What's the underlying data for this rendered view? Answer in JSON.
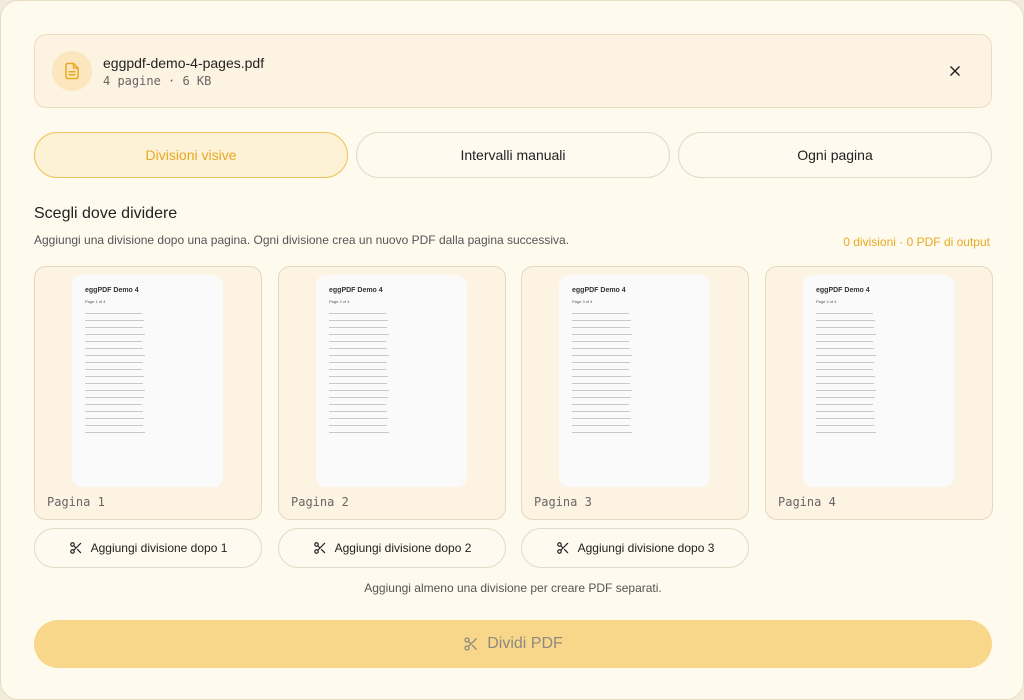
{
  "file": {
    "name": "eggpdf-demo-4-pages.pdf",
    "meta": "4 pagine · 6 KB",
    "icon": "file-text-icon",
    "close_icon": "close-icon"
  },
  "tabs": [
    {
      "label": "Divisioni visive",
      "active": true
    },
    {
      "label": "Intervalli manuali",
      "active": false
    },
    {
      "label": "Ogni pagina",
      "active": false
    }
  ],
  "section": {
    "title": "Scegli dove dividere",
    "description": "Aggiungi una divisione dopo una pagina. Ogni divisione crea un nuovo PDF dalla pagina successiva.",
    "summary": "0 divisioni · 0 PDF di output"
  },
  "pages": [
    {
      "label": "Pagina 1",
      "thumb_title": "eggPDF Demo 4",
      "thumb_sub": "Page 1 of 4"
    },
    {
      "label": "Pagina 2",
      "thumb_title": "eggPDF Demo 4",
      "thumb_sub": "Page 2 of 4"
    },
    {
      "label": "Pagina 3",
      "thumb_title": "eggPDF Demo 4",
      "thumb_sub": "Page 3 of 4"
    },
    {
      "label": "Pagina 4",
      "thumb_title": "eggPDF Demo 4",
      "thumb_sub": "Page 4 of 4"
    }
  ],
  "split_buttons": [
    {
      "label": "Aggiungi divisione dopo 1",
      "icon": "scissors-icon"
    },
    {
      "label": "Aggiungi divisione dopo 2",
      "icon": "scissors-icon"
    },
    {
      "label": "Aggiungi divisione dopo 3",
      "icon": "scissors-icon"
    }
  ],
  "hint": "Aggiungi almeno una divisione per creare PDF separati.",
  "primary": {
    "label": "Dividi PDF",
    "icon": "scissors-icon",
    "disabled": true
  },
  "colors": {
    "accent": "#e6a923",
    "background": "#fffaee",
    "card": "#fdf3e2",
    "primary_disabled": "#f8d78a"
  }
}
